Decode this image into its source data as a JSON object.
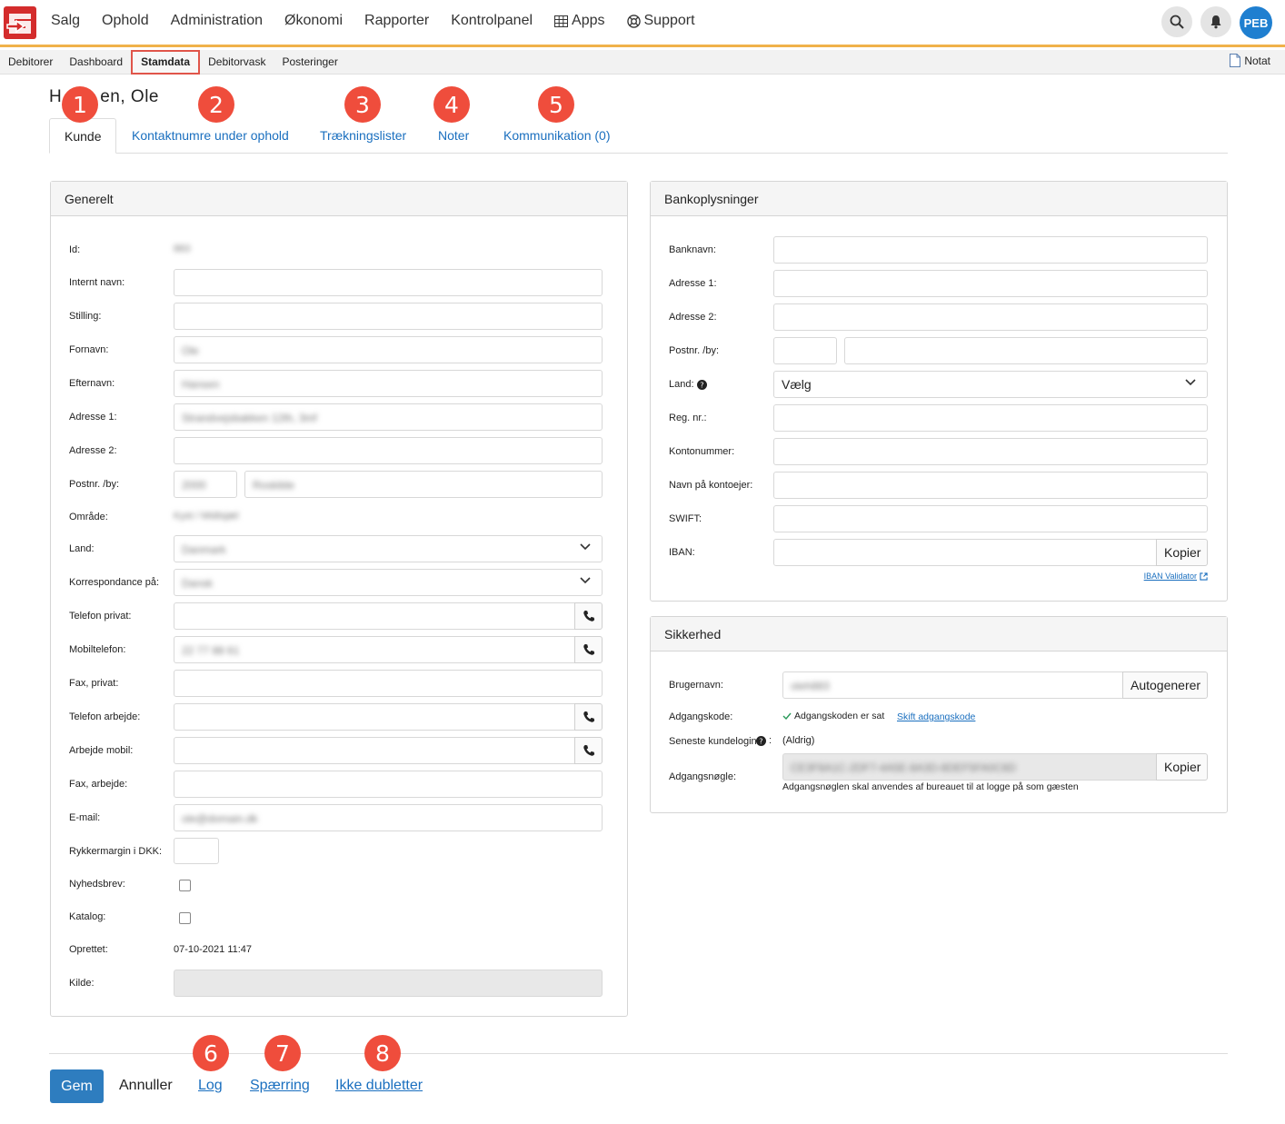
{
  "topbar": {
    "nav": [
      {
        "label": "Salg"
      },
      {
        "label": "Ophold"
      },
      {
        "label": "Administration"
      },
      {
        "label": "Økonomi"
      },
      {
        "label": "Rapporter"
      },
      {
        "label": "Kontrolpanel"
      },
      {
        "label": "Apps",
        "icon": "grid-icon"
      },
      {
        "label": "Support",
        "icon": "lifebuoy-icon"
      }
    ],
    "user_initials": "PEB",
    "accent_color": "#f0b24a",
    "brand_color": "#d42c2c"
  },
  "subnav": {
    "items": [
      "Debitorer",
      "Dashboard",
      "Stamdata",
      "Debitorvask",
      "Posteringer"
    ],
    "active": "Stamdata",
    "notat_label": "Notat"
  },
  "customer": {
    "name": "H",
    "name_rest": "en, Ole"
  },
  "tabs": [
    "Kunde",
    "Kontaktnumre under ophold",
    "Trækningslister",
    "Noter",
    "Kommunikation (0)"
  ],
  "badges": [
    "1",
    "2",
    "3",
    "4",
    "5",
    "6",
    "7",
    "8"
  ],
  "general": {
    "title": "Generelt",
    "labels": {
      "id": "Id:",
      "internal_name": "Internt navn:",
      "position": "Stilling:",
      "first_name": "Fornavn:",
      "last_name": "Efternavn:",
      "address1": "Adresse 1:",
      "address2": "Adresse 2:",
      "zip_city": "Postnr. /by:",
      "area": "Område:",
      "country": "Land:",
      "correspondence": "Korrespondance på:",
      "phone_private": "Telefon privat:",
      "mobile": "Mobiltelefon:",
      "fax_private": "Fax, privat:",
      "phone_work": "Telefon arbejde:",
      "mobile_work": "Arbejde mobil:",
      "fax_work": "Fax, arbejde:",
      "email": "E-mail:",
      "reminder_margin": "Rykkermargin i DKK:",
      "newsletter": "Nyhedsbrev:",
      "catalog": "Katalog:",
      "created": "Oprettet:",
      "source": "Kilde:"
    },
    "values": {
      "id": "883",
      "first_name": "Ole",
      "last_name": "Hansen",
      "address1": "Strandvejsbakken 12th, 3mf",
      "zip": "2000",
      "city": "Roskilde",
      "area": "Kyst / Midtsjæl",
      "country": "Danmark",
      "correspondence": "Dansk",
      "mobile": "22 77 88 61",
      "email": "ole@domain.dk",
      "created": "07-10-2021 11:47"
    }
  },
  "bank": {
    "title": "Bankoplysninger",
    "labels": {
      "bank_name": "Banknavn:",
      "address1": "Adresse 1:",
      "address2": "Adresse 2:",
      "zip_city": "Postnr. /by:",
      "country": "Land:",
      "reg_no": "Reg. nr.:",
      "account_no": "Kontonummer:",
      "account_holder": "Navn på kontoejer:",
      "swift": "SWIFT:",
      "iban": "IBAN:"
    },
    "country_value": "Vælg",
    "copy_label": "Kopier",
    "iban_validator": "IBAN Validator"
  },
  "security": {
    "title": "Sikkerhed",
    "labels": {
      "username": "Brugernavn:",
      "password": "Adgangskode:",
      "last_login": "Seneste kundelogin",
      "access_key": "Adgangsnøgle:"
    },
    "username_value": "oleh883",
    "autogenerate_label": "Autogenerer",
    "password_status": "Adgangskoden er sat",
    "change_password": "Skift adgangskode",
    "last_login_value": "(Aldrig)",
    "access_key_value": "CE3F8A1C-2DF7-4A5E-8A3D-8DEF5FA0C6D",
    "copy_label": "Kopier",
    "access_key_note": "Adgangsnøglen skal anvendes af bureauet til at logge på som gæsten"
  },
  "footer": {
    "save": "Gem",
    "cancel": "Annuller",
    "log": "Log",
    "block": "Spærring",
    "not_duplicates": "Ikke dubletter"
  }
}
